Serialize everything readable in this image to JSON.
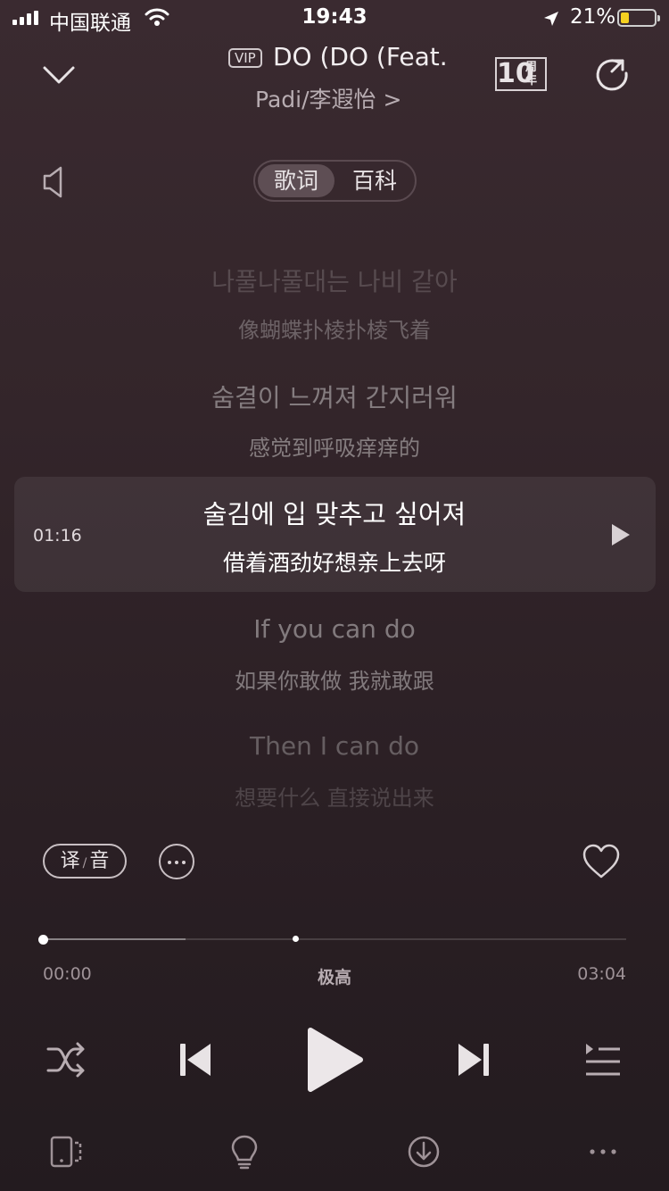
{
  "status_bar": {
    "carrier": "中国联通",
    "time": "19:43",
    "battery_percent": "21%",
    "battery_level": 0.21
  },
  "header": {
    "badge": "VIP",
    "title": "DO (DO (Feat. L",
    "artist": "Padi/李遐怡 >",
    "anniversary_mark": "10",
    "anniversary_text_1": "周",
    "anniversary_text_2": "年"
  },
  "tabs": {
    "lyrics": "歌词",
    "encyclopedia": "百科"
  },
  "lyrics": [
    {
      "ko": "나풀나풀대는 나비 같아",
      "zh": "像蝴蝶扑棱扑棱飞着"
    },
    {
      "ko": "숨결이 느껴져 간지러워",
      "zh": "感觉到呼吸痒痒的"
    },
    {
      "ko": "술김에 입 맞추고 싶어져",
      "zh": "借着酒劲好想亲上去呀",
      "time": "01:16",
      "current": true
    },
    {
      "ko": "If you can do",
      "zh": "如果你敢做 我就敢跟"
    },
    {
      "ko": "Then I can do",
      "zh": "想要什么 直接说出来"
    }
  ],
  "actions": {
    "translate_a": "译",
    "translate_sep": "/",
    "translate_b": "音"
  },
  "progress": {
    "current": "00:00",
    "total": "03:04",
    "quality": "极高",
    "position_fraction": 0.0,
    "buffered_fraction": 0.245
  },
  "icons": {
    "collapse": "chevron-down-icon",
    "share": "share-icon",
    "speaker": "speaker-icon",
    "line_play": "play-icon",
    "more": "more-icon",
    "heart": "heart-icon",
    "shuffle": "shuffle-icon",
    "prev": "previous-icon",
    "play": "play-icon",
    "next": "next-icon",
    "playlist": "playlist-icon",
    "device": "device-icon",
    "tips": "lightbulb-icon",
    "download": "download-icon",
    "menu": "more-horizontal-icon"
  }
}
